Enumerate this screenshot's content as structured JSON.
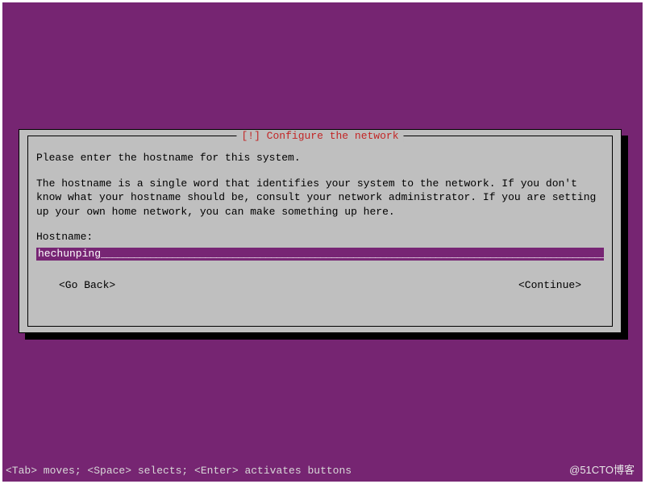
{
  "dialog": {
    "title": "[!] Configure the network",
    "instruction": "Please enter the hostname for this system.",
    "help_text": "The hostname is a single word that identifies your system to the network. If you don't know what your hostname should be, consult your network administrator. If you are setting up your own home network, you can make something up here.",
    "field_label": "Hostname:",
    "input_value": "hechunping",
    "go_back_label": "<Go Back>",
    "continue_label": "<Continue>"
  },
  "status_bar": "<Tab> moves; <Space> selects; <Enter> activates buttons",
  "watermark": "@51CTO博客",
  "colors": {
    "desktop_bg": "#762572",
    "dialog_bg": "#bfbfbf",
    "title_color": "#c22626",
    "input_bg": "#772574",
    "input_text": "#ffffff"
  }
}
